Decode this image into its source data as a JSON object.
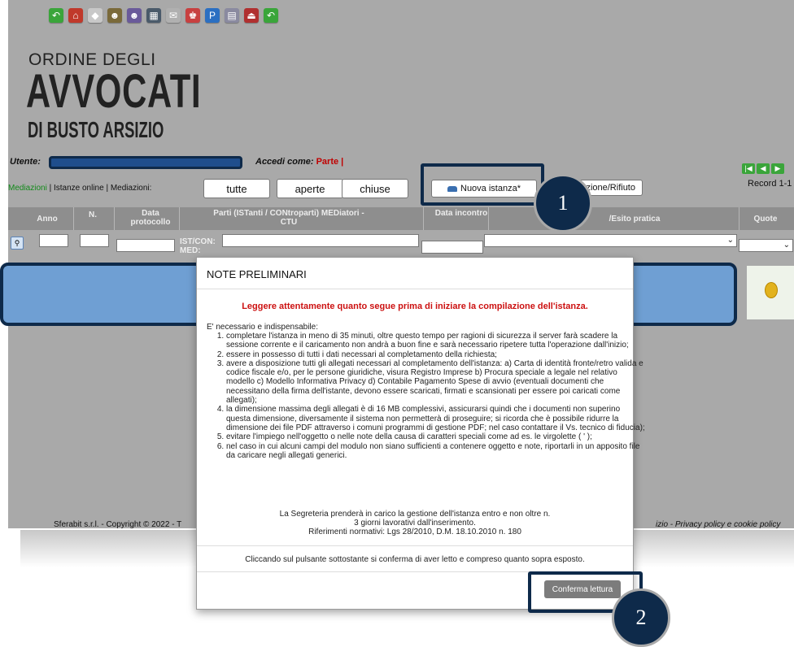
{
  "toolbar": {
    "icons": [
      {
        "name": "back-arrow-icon",
        "color": "#3aa53a",
        "glyph": "↶"
      },
      {
        "name": "home-icon",
        "color": "#c0392b",
        "glyph": "⌂"
      },
      {
        "name": "disabled-icon",
        "color": "#c8c8c8",
        "glyph": "◆"
      },
      {
        "name": "users-icon",
        "color": "#7a6a3a",
        "glyph": "☻"
      },
      {
        "name": "user-search-icon",
        "color": "#6a5a9a",
        "glyph": "☻"
      },
      {
        "name": "notebook-icon",
        "color": "#4a5a6a",
        "glyph": "▦"
      },
      {
        "name": "mail-icon",
        "color": "#b0b0b0",
        "glyph": "✉"
      },
      {
        "name": "people-icon",
        "color": "#c84040",
        "glyph": "♚"
      },
      {
        "name": "paypal-icon",
        "color": "#2b6fc2",
        "glyph": "P"
      },
      {
        "name": "print-icon",
        "color": "#8a8aa0",
        "glyph": "▤"
      },
      {
        "name": "exit-icon",
        "color": "#b03030",
        "glyph": "⏏"
      },
      {
        "name": "refresh-icon",
        "color": "#3aa53a",
        "glyph": "↶"
      }
    ]
  },
  "logo": {
    "top": "ORDINE DEGLI",
    "mid": "AVVOCATI",
    "bot": "DI BUSTO ARSIZIO"
  },
  "user": {
    "label": "Utente:",
    "accedi_label": "Accedi come:",
    "accedi_value": "Parte |"
  },
  "nav": {
    "link": "Mediazioni",
    "rest": " | Istanze online | Mediazioni:"
  },
  "filters": {
    "tutte": "tutte",
    "aperte": "aperte",
    "chiuse": "chiuse"
  },
  "actions": {
    "nuova": "Nuova istanza*",
    "rifiuto": "zione/Rifiuto"
  },
  "pager": {
    "record": "Record 1-1"
  },
  "table": {
    "headers": {
      "anno": "Anno",
      "n": "N.",
      "data": "Data protocollo",
      "parti": "Parti (ISTanti / CONtroparti) MEDiatori - CTU",
      "data_incontro": "Data incontro",
      "esito": "/Esito pratica",
      "quote": "Quote"
    },
    "filter_labels": {
      "istcon": "IST/CON:",
      "med": "MED:"
    }
  },
  "badges": {
    "one": "1",
    "two": "2"
  },
  "footer": {
    "left": "Sferabit s.r.l. - Copyright © 2022 - T",
    "right": "izio - Privacy policy e cookie policy"
  },
  "modal": {
    "title": "NOTE PRELIMINARI",
    "warning": "Leggere attentamente quanto segue prima di iniziare la compilazione dell'istanza.",
    "intro": "E' necessario e indispensabile:",
    "items": [
      "completare l'istanza in meno di 35 minuti, oltre questo tempo per ragioni di sicurezza il server farà scadere la sessione corrente e il caricamento non andrà a buon fine e sarà necessario ripetere tutta l'operazione dall'inizio;",
      "essere in possesso di tutti i dati necessari al completamento della richiesta;",
      "avere a disposizione tutti gli allegati necessari al completamento dell'istanza: a) Carta di identità fronte/retro valida e codice fiscale e/o, per le persone giuridiche, visura Registro Imprese b) Procura speciale a legale nel relativo modello c) Modello Informativa Privacy d) Contabile Pagamento Spese di avvio (eventuali documenti che necessitano della firma dell'istante, devono essere scaricati, firmati e scansionati per essere poi caricati come allegati);",
      "la dimensione massima degli allegati è di 16 MB complessivi, assicurarsi quindi che i documenti non superino questa dimensione, diversamente il sistema non permetterà di proseguire; si ricorda che è possibile ridurre la dimensione dei file PDF attraverso i comuni programmi di gestione PDF; nel caso contattare il Vs. tecnico di fiducia);",
      "evitare l'impiego nell'oggetto o nelle note della causa di caratteri speciali come ad es. le virgolette ( ' );",
      "nel caso in cui alcuni campi del modulo non siano sufficienti a contenere oggetto e note, riportarli in un apposito file da caricare negli allegati generici."
    ],
    "note1": "La Segreteria prenderà in carico la gestione dell'istanza entro e non oltre n. 3 giorni lavorativi dall'inserimento.",
    "note2": "Riferimenti normativi: Lgs 28/2010, D.M. 18.10.2010 n. 180",
    "confirm_text": "Cliccando sul pulsante sottostante si conferma di aver letto e compreso quanto sopra esposto.",
    "confirm_button": "Conferma lettura"
  }
}
